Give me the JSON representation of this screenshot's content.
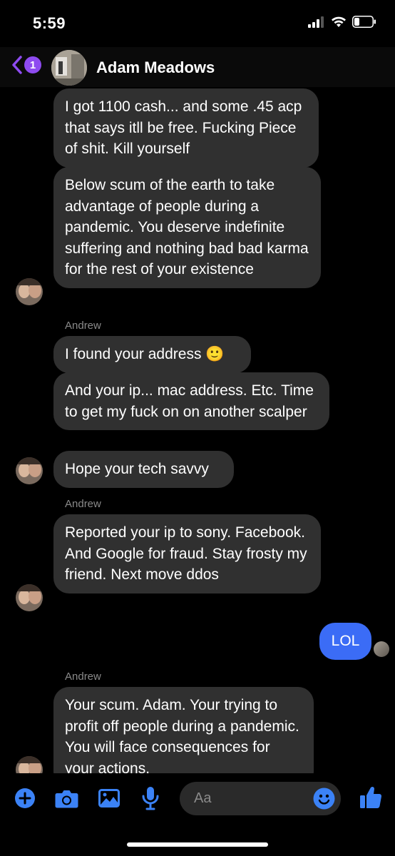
{
  "status": {
    "time": "5:59"
  },
  "header": {
    "back_count": "1",
    "contact_name": "Adam Meadows"
  },
  "messages": [
    {
      "text": "I got 1100 cash... and some .45 acp that says itll be free. Fucking Piece of shit. Kill yourself"
    },
    {
      "text": "Below scum of the earth to take advantage of people during a pandemic. You deserve indefinite suffering and nothing bad bad karma for the rest of your existence"
    },
    {
      "sender": "Andrew"
    },
    {
      "text": "I found your address 🙂"
    },
    {
      "text": "And your ip... mac address. Etc. Time to get my fuck on on another scalper"
    },
    {
      "text": "Hope your tech savvy"
    },
    {
      "sender": "Andrew"
    },
    {
      "text": "Reported your ip to sony. Facebook. And Google  for fraud. Stay frosty my friend. Next move ddos"
    },
    {
      "text": "LOL"
    },
    {
      "sender": "Andrew"
    },
    {
      "text": "Your scum. Adam. Your trying to profit off people during a pandemic. You will face consequences for your actions."
    }
  ],
  "composer": {
    "placeholder": "Aa",
    "icons": [
      "plus-icon",
      "camera-icon",
      "gallery-icon",
      "microphone-icon",
      "emoji-icon",
      "thumbs-up-icon"
    ]
  },
  "colors": {
    "accent": "#3b6cf6",
    "incoming_bubble": "#303030",
    "badge": "#8e4bf0",
    "icon_blue": "#3b82f6"
  }
}
